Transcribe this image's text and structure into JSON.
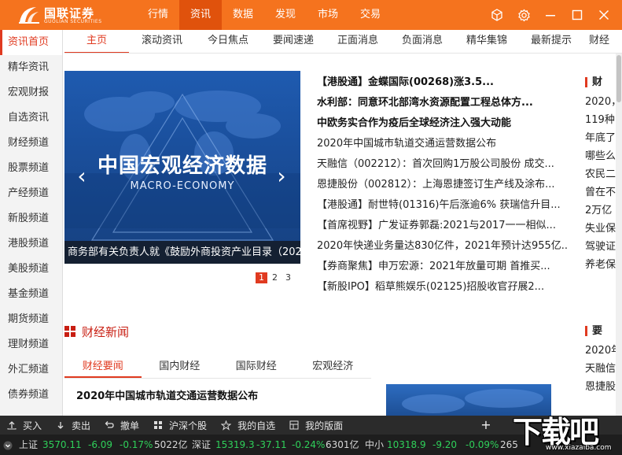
{
  "app": {
    "logo_text": "国联证券",
    "logo_sub": "GUOLIAN SECURITIES"
  },
  "top_menu": [
    {
      "label": "行情",
      "active": false
    },
    {
      "label": "资讯",
      "active": true
    },
    {
      "label": "数据",
      "active": false
    },
    {
      "label": "发现",
      "active": false
    },
    {
      "label": "市场",
      "active": false
    },
    {
      "label": "交易",
      "active": false
    }
  ],
  "window_controls": [
    "cube-icon",
    "gear-icon",
    "minimize-icon",
    "maximize-icon",
    "close-icon"
  ],
  "side_nav": [
    {
      "label": "资讯首页",
      "active": true
    },
    {
      "label": "精华资讯"
    },
    {
      "label": "宏观财报"
    },
    {
      "label": "自选资讯"
    },
    {
      "label": "财经频道"
    },
    {
      "label": "股票频道"
    },
    {
      "label": "产经频道"
    },
    {
      "label": "新股频道"
    },
    {
      "label": "港股频道"
    },
    {
      "label": "美股频道"
    },
    {
      "label": "基金频道"
    },
    {
      "label": "期货频道"
    },
    {
      "label": "理财频道"
    },
    {
      "label": "外汇频道"
    },
    {
      "label": "债券频道"
    }
  ],
  "sub_tabs": [
    {
      "label": "主页",
      "active": true
    },
    {
      "label": "滚动资讯"
    },
    {
      "label": "今日焦点"
    },
    {
      "label": "要闻速递"
    },
    {
      "label": "正面消息"
    },
    {
      "label": "负面消息"
    },
    {
      "label": "精华集锦"
    },
    {
      "label": "最新提示"
    },
    {
      "label": "财经"
    }
  ],
  "banner": {
    "title": "中国宏观经济数据",
    "subtitle": "MACRO-ECONOMY",
    "caption": "商务部有关负责人就《鼓励外商投资产业目录（2020年版）》答记者问",
    "pages": [
      "1",
      "2",
      "3"
    ],
    "active_page": 0
  },
  "headlines": [
    {
      "text": "【港股通】金蝶国际(00268)涨3.5...",
      "bold": true
    },
    {
      "text": "水利部：同意环北部湾水资源配置工程总体方...",
      "bold": true
    },
    {
      "text": "中欧务实合作为疫后全球经济注入强大动能",
      "bold": true
    },
    {
      "text": "2020年中国城市轨道交通运营数据公布",
      "bold": false
    },
    {
      "text": "天融信（002212）：首次回购1万股公司股份 成交...",
      "bold": false
    },
    {
      "text": "恩捷股份（002812）：上海恩捷签订生产线及涂布...",
      "bold": false
    },
    {
      "text": "【港股通】耐世特(01316)午后涨逾6% 获瑞信升目...",
      "bold": false
    },
    {
      "text": "【首席视野】广发证券郭磊:2021与2017一一相似...",
      "bold": false
    },
    {
      "text": "2020年快递业务量达830亿件，2021年预计达955亿...",
      "bold": false
    },
    {
      "text": "【券商聚焦】申万宏源：2021年放量可期 首推买...",
      "bold": false
    },
    {
      "text": "【新股IPO】稻草熊娱乐(02125)招股收官孖展2...",
      "bold": false
    }
  ],
  "right_col": {
    "heading": "财",
    "lines": [
      "2020，",
      "119种",
      "年底了",
      "哪些么",
      "农民二",
      "曾在不",
      "2万亿",
      "失业保",
      "驾驶证",
      "养老保"
    ]
  },
  "right_col2": {
    "heading": "要",
    "lines": [
      "2020年",
      "天融信",
      "恩捷股"
    ]
  },
  "finance_section": {
    "title": "财经新闻",
    "tabs": [
      {
        "label": "财经要闻",
        "active": true
      },
      {
        "label": "国内财经"
      },
      {
        "label": "国际财经"
      },
      {
        "label": "宏观经济"
      }
    ],
    "first_item": "2020年中国城市轨道交通运营数据公布"
  },
  "trade_bar": [
    {
      "label": "买入",
      "icon": "buy-icon"
    },
    {
      "label": "卖出",
      "icon": "sell-icon"
    },
    {
      "label": "撤单",
      "icon": "cancel-order-icon"
    },
    {
      "label": "沪深个股",
      "icon": "stock-grid-icon"
    },
    {
      "label": "我的自选",
      "icon": "star-icon"
    },
    {
      "label": "我的版面",
      "icon": "layout-icon"
    }
  ],
  "ticker": [
    {
      "name": "上证",
      "value": "3570.11",
      "change": "-6.09",
      "pct": "-0.17%",
      "volume": "5022亿"
    },
    {
      "name": "深证",
      "value": "15319.3",
      "change": "-37.11",
      "pct": "-0.24%",
      "volume": "6301亿"
    },
    {
      "name": "中小",
      "value": "10318.9",
      "change": "-9.20",
      "pct": "-0.09%",
      "volume": "265"
    }
  ],
  "watermark": {
    "text": "下载吧",
    "url": "www.xiazaiba.com"
  },
  "colors": {
    "brand_orange": "#f5731e",
    "accent_red": "#e03a20",
    "ticker_down": "#2fd05a"
  }
}
